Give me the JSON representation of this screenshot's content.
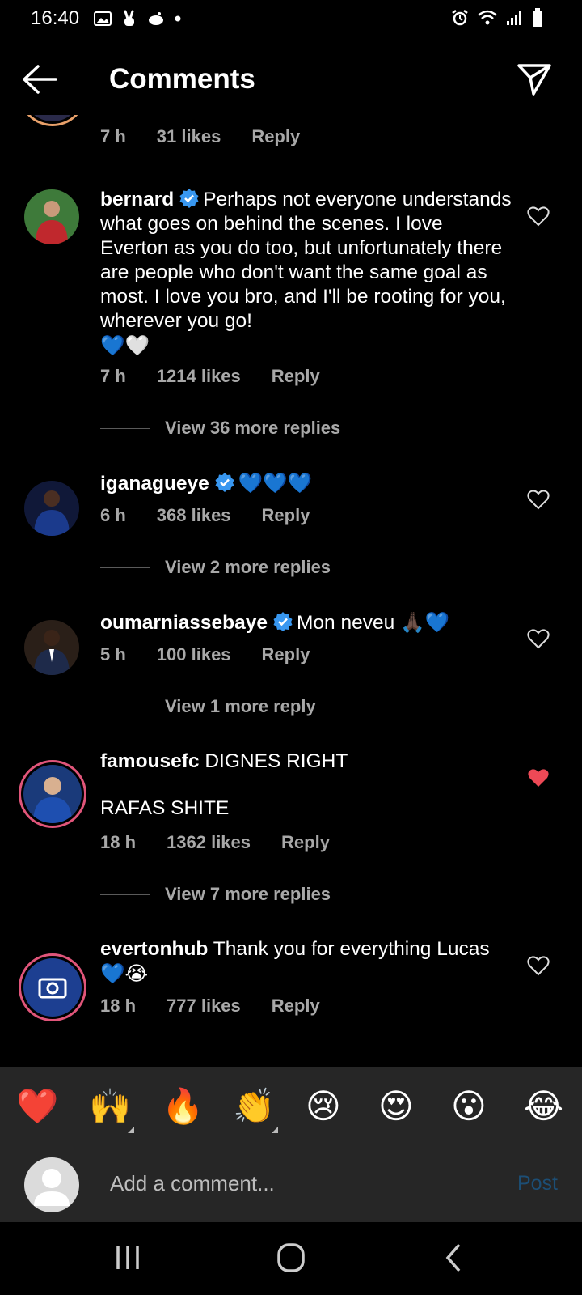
{
  "status_bar": {
    "time": "16:40"
  },
  "header": {
    "title": "Comments"
  },
  "comments": [
    {
      "meta": {
        "time": "7 h",
        "likes": "31 likes",
        "reply": "Reply"
      }
    },
    {
      "username": "bernard",
      "verified": true,
      "text": "Perhaps not everyone understands what goes on behind the scenes. I love Everton as you do too, but unfortunately there are people who don't want the same goal as most. I love you bro, and I'll be rooting for you, wherever you go!",
      "emoji": "💙🤍",
      "meta": {
        "time": "7 h",
        "likes": "1214 likes",
        "reply": "Reply"
      },
      "view_more": "View 36 more replies"
    },
    {
      "username": "iganagueye",
      "verified": true,
      "text": "",
      "emoji": "💙💙💙",
      "meta": {
        "time": "6 h",
        "likes": "368 likes",
        "reply": "Reply"
      },
      "view_more": "View 2 more replies"
    },
    {
      "username": "oumarniassebaye",
      "verified": true,
      "text": "Mon neveu",
      "emoji": "🙏🏿💙",
      "meta": {
        "time": "5 h",
        "likes": "100 likes",
        "reply": "Reply"
      },
      "view_more": "View 1 more reply"
    },
    {
      "username": "famousefc",
      "verified": false,
      "text": "DIGNES RIGHT",
      "text2": "RAFAS SHITE",
      "liked": true,
      "meta": {
        "time": "18 h",
        "likes": "1362 likes",
        "reply": "Reply"
      },
      "view_more": "View 7 more replies"
    },
    {
      "username": "evertonhub",
      "verified": false,
      "text": "Thank you for everything Lucas",
      "emoji": "💙😭",
      "meta": {
        "time": "18 h",
        "likes": "777 likes",
        "reply": "Reply"
      }
    }
  ],
  "emoji_bar": [
    "❤️",
    "🙌",
    "🔥",
    "👏",
    "😢",
    "😍",
    "😮",
    "😂"
  ],
  "input": {
    "placeholder": "Add a comment...",
    "post_label": "Post"
  },
  "colors": {
    "background": "#000000",
    "secondary_text": "#a8a8a8",
    "liked_heart": "#ed4956",
    "verified_badge": "#3897f0",
    "post_disabled": "#1c4e75",
    "story_ring": "#e0557a"
  }
}
